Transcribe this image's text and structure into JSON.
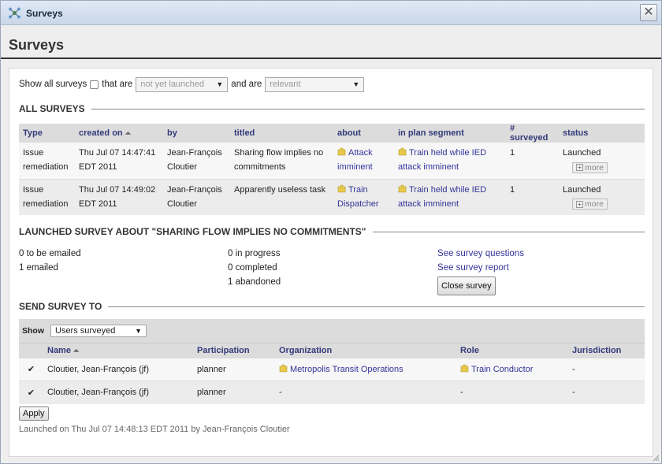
{
  "window": {
    "title": "Surveys",
    "close_glyph": "✕"
  },
  "page": {
    "title": "Surveys"
  },
  "filters": {
    "show_all_label": "Show all surveys",
    "that_are_label": "that are",
    "status_select": "not yet launched",
    "and_are_label": "and are",
    "relevance_select": "relevant"
  },
  "all_surveys": {
    "heading": "ALL SURVEYS",
    "columns": [
      "Type",
      "created on",
      "by",
      "titled",
      "about",
      "in plan segment",
      "# surveyed",
      "status"
    ],
    "sort_glyph": "⏶",
    "more_label": "more",
    "rows": [
      {
        "type": "Issue remediation",
        "created": "Thu Jul 07 14:47:41 EDT 2011",
        "by": "Jean-François Cloutier",
        "titled": "Sharing flow implies no commitments",
        "about": "Attack imminent",
        "segment": "Train held while IED attack imminent",
        "surveyed": "1",
        "status": "Launched"
      },
      {
        "type": "Issue remediation",
        "created": "Thu Jul 07 14:49:02 EDT 2011",
        "by": "Jean-François Cloutier",
        "titled": "Apparently useless task",
        "about": "Train Dispatcher",
        "segment": "Train held while IED attack imminent",
        "surveyed": "1",
        "status": "Launched"
      }
    ]
  },
  "launched": {
    "heading": "LAUNCHED SURVEY ABOUT \"SHARING FLOW IMPLIES NO COMMITMENTS\"",
    "to_be_emailed": "0 to be emailed",
    "emailed": "1 emailed",
    "in_progress": "0 in progress",
    "completed": "0 completed",
    "abandoned": "1 abandoned",
    "see_questions": "See survey questions",
    "see_report": "See survey report",
    "close_survey": "Close survey"
  },
  "send_to": {
    "heading": "SEND SURVEY TO",
    "show_label": "Show",
    "show_select": "Users surveyed",
    "columns": [
      "Name",
      "Participation",
      "Organization",
      "Role",
      "Jurisdiction"
    ],
    "check_glyph": "✔",
    "rows": [
      {
        "name": "Cloutier, Jean-François (jf)",
        "participation": "planner",
        "organization": "Metropolis Transit Operations",
        "role": "Train Conductor",
        "jurisdiction": "-"
      },
      {
        "name": "Cloutier, Jean-François (jf)",
        "participation": "planner",
        "organization": "-",
        "role": "-",
        "jurisdiction": "-"
      }
    ],
    "apply_label": "Apply",
    "footer": "Launched on Thu Jul 07 14:48:13 EDT 2011 by Jean-François Cloutier"
  },
  "colors": {
    "link": "#333399",
    "header_bg": "#dcdcdc",
    "chip": "#e6c84a"
  }
}
